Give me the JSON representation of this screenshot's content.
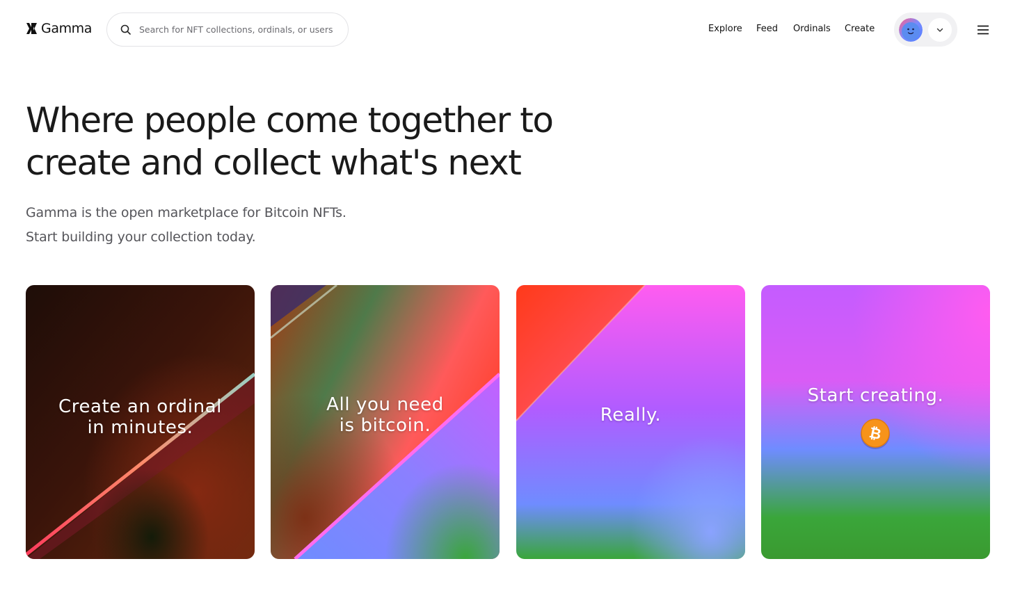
{
  "header": {
    "logo_text": "Gamma",
    "search": {
      "placeholder": "Search for NFT collections, ordinals, or users"
    },
    "nav": [
      {
        "label": "Explore"
      },
      {
        "label": "Feed"
      },
      {
        "label": "Ordinals"
      },
      {
        "label": "Create"
      }
    ],
    "icons": {
      "search": "search-icon",
      "profile_dropdown": "chevron-down-icon",
      "menu": "hamburger-menu-icon"
    }
  },
  "hero": {
    "headline_line1": "Where people come together to",
    "headline_line2": "create and collect what's next",
    "subtitle_line1": "Gamma is the open marketplace for Bitcoin NFTs.",
    "subtitle_line2": "Start building your collection today."
  },
  "cards": [
    {
      "text": "Create an ordinal\nin minutes."
    },
    {
      "text": "All you need\nis bitcoin."
    },
    {
      "text": "Really."
    },
    {
      "text": "Start creating.",
      "icon": "bitcoin-coin-icon"
    }
  ],
  "colors": {
    "bitcoin_orange": "#f7931a",
    "gradient_pink": "#ff5cf0",
    "gradient_purple": "#b65cff",
    "gradient_blue": "#6f8cff",
    "gradient_green": "#3aa63a",
    "gradient_red": "#ff3a1a"
  }
}
